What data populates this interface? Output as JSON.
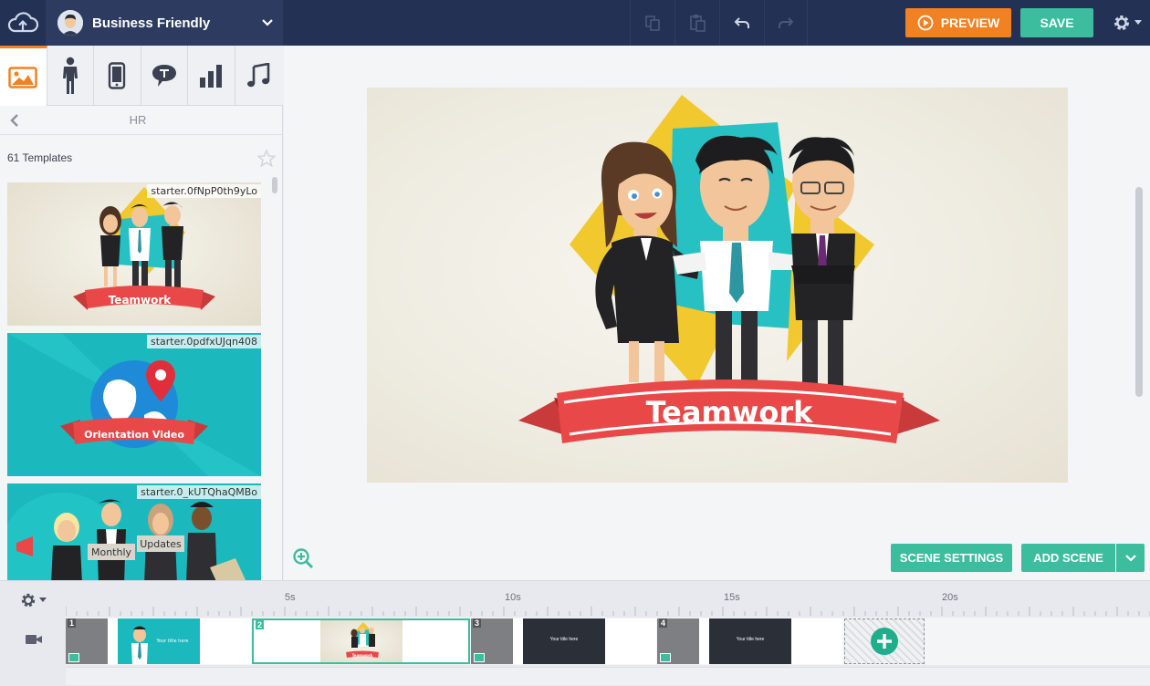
{
  "header": {
    "project_title": "Business Friendly",
    "preview_label": "PREVIEW",
    "save_label": "SAVE"
  },
  "left_panel": {
    "category": "HR",
    "count_text": "61 Templates",
    "templates": [
      {
        "id": "starter.0fNpP0th9yLo",
        "banner": "Teamwork"
      },
      {
        "id": "starter.0pdfxUJqn408",
        "banner": "Orientation Video"
      },
      {
        "id": "starter.0_kUTQhaQMBo",
        "signs": [
          "Monthly",
          "Updates"
        ]
      }
    ]
  },
  "stage": {
    "banner_text": "Teamwork"
  },
  "canvas_buttons": {
    "scene_settings": "SCENE SETTINGS",
    "add_scene": "ADD SCENE"
  },
  "timeline": {
    "ticks": [
      "5s",
      "10s",
      "15s",
      "20s"
    ],
    "scenes": [
      {
        "number": "1",
        "thumb_text": "Your title here"
      },
      {
        "number": "2",
        "thumb_text": "Teamwork"
      },
      {
        "number": "3",
        "thumb_text": "Your title here"
      },
      {
        "number": "4",
        "thumb_text": "Your title here"
      }
    ]
  },
  "colors": {
    "topbar": "#233155",
    "accent_orange": "#f28124",
    "accent_green": "#3cbd9d",
    "banner_red": "#e84848"
  }
}
